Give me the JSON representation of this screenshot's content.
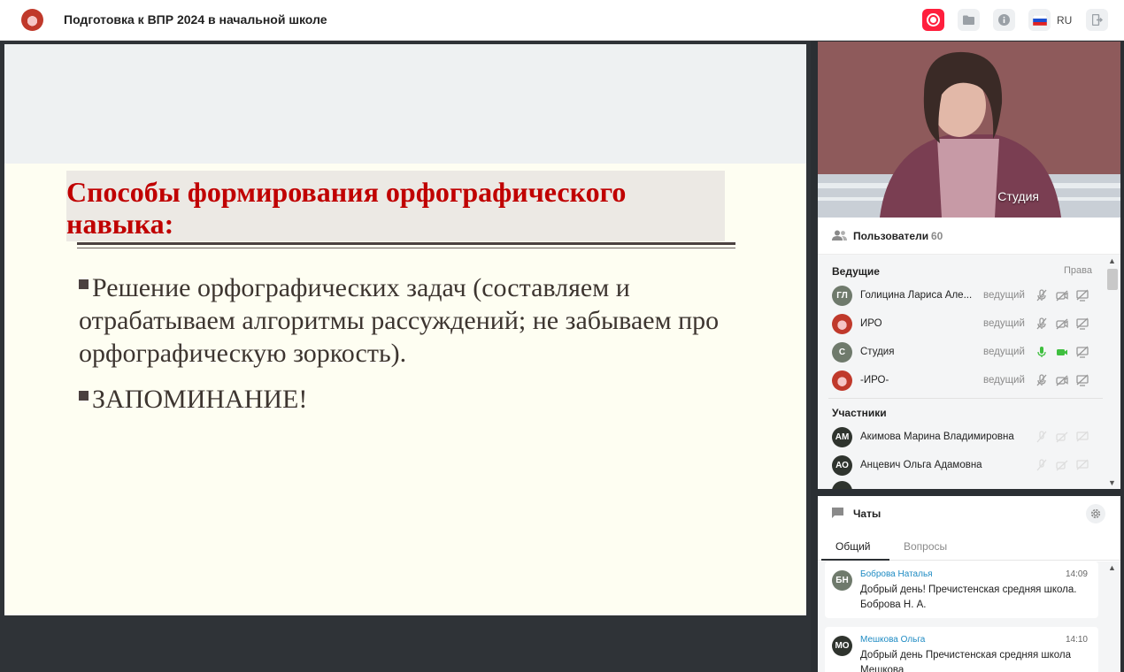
{
  "header": {
    "title": "Подготовка к ВПР 2024 в начальной школе",
    "lang": "RU"
  },
  "slide": {
    "title": "Способы формирования орфографического навыка:",
    "bullets": [
      "Решение орфографических задач (составляем и отрабатываем алгоритмы рассуждений; не забываем про орфографическую зоркость).",
      "ЗАПОМИНАНИЕ!"
    ]
  },
  "video": {
    "label": "Студия"
  },
  "users": {
    "header": "Пользователи",
    "count": "60",
    "hosts_title": "Ведущие",
    "rights_label": "Права",
    "hosts": [
      {
        "initials": "ГЛ",
        "name": "Голицина Лариса Але...",
        "role": "ведущий",
        "mic": "off",
        "cam": "off"
      },
      {
        "initials": "",
        "name": "ИРО",
        "role": "ведущий",
        "mic": "off",
        "cam": "off"
      },
      {
        "initials": "С",
        "name": "Студия",
        "role": "ведущий",
        "mic": "on",
        "cam": "on"
      },
      {
        "initials": "",
        "name": "-ИРО-",
        "role": "ведущий",
        "mic": "off",
        "cam": "off"
      }
    ],
    "participants_title": "Участники",
    "participants": [
      {
        "initials": "АМ",
        "name": "Акимова Марина Владимировна"
      },
      {
        "initials": "АО",
        "name": "Анцевич Ольга Адамовна"
      }
    ]
  },
  "chats": {
    "header": "Чаты",
    "tabs": [
      "Общий",
      "Вопросы"
    ],
    "messages": [
      {
        "initials": "БН",
        "author": "Боброва Наталья",
        "time": "14:09",
        "text": "Добрый день! Пречистенская средняя школа. Боброва Н. А."
      },
      {
        "initials": "МО",
        "author": "Мешкова Ольга",
        "time": "14:10",
        "text": "Добрый день Пречистенская средняя школа Мешкова"
      }
    ]
  },
  "colors": {
    "accent_red": "#ff1f3d",
    "slide_title": "#c00000",
    "link_blue": "#1e8bc3",
    "mic_on": "#3fbf3f"
  }
}
